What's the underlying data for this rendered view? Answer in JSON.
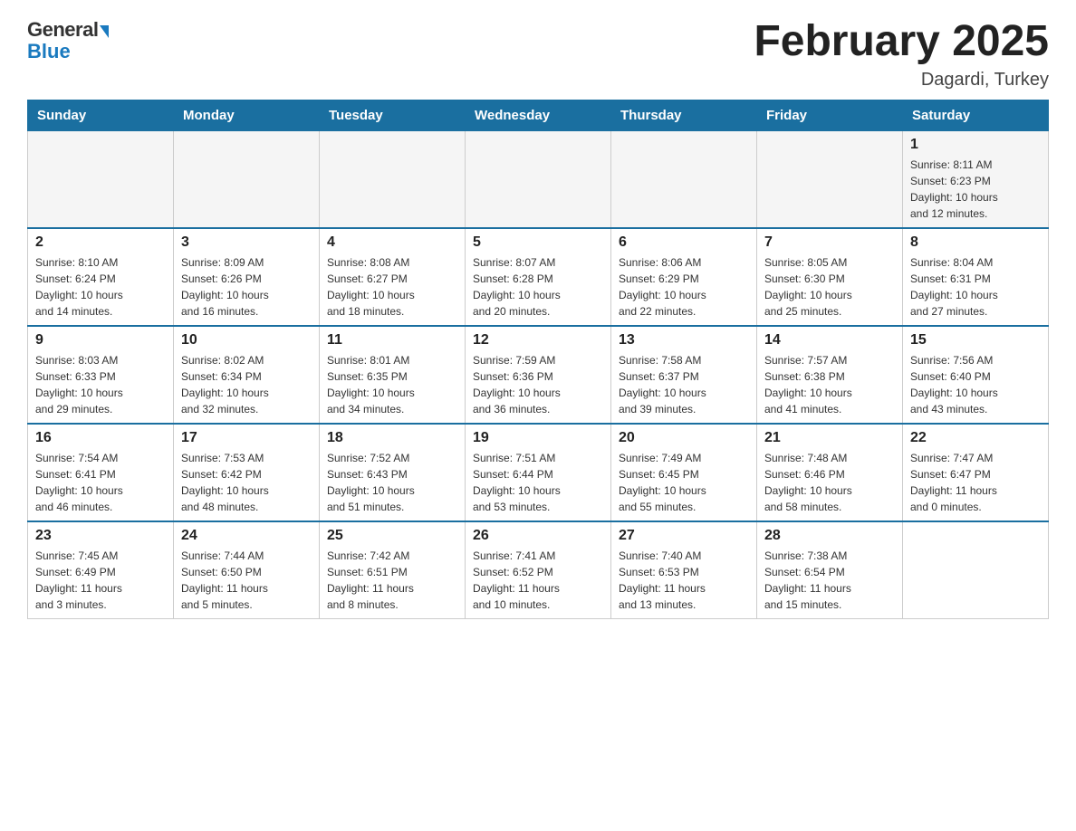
{
  "logo": {
    "general": "General",
    "blue": "Blue"
  },
  "header": {
    "title": "February 2025",
    "location": "Dagardi, Turkey"
  },
  "weekdays": [
    "Sunday",
    "Monday",
    "Tuesday",
    "Wednesday",
    "Thursday",
    "Friday",
    "Saturday"
  ],
  "weeks": [
    [
      {
        "day": "",
        "info": ""
      },
      {
        "day": "",
        "info": ""
      },
      {
        "day": "",
        "info": ""
      },
      {
        "day": "",
        "info": ""
      },
      {
        "day": "",
        "info": ""
      },
      {
        "day": "",
        "info": ""
      },
      {
        "day": "1",
        "info": "Sunrise: 8:11 AM\nSunset: 6:23 PM\nDaylight: 10 hours\nand 12 minutes."
      }
    ],
    [
      {
        "day": "2",
        "info": "Sunrise: 8:10 AM\nSunset: 6:24 PM\nDaylight: 10 hours\nand 14 minutes."
      },
      {
        "day": "3",
        "info": "Sunrise: 8:09 AM\nSunset: 6:26 PM\nDaylight: 10 hours\nand 16 minutes."
      },
      {
        "day": "4",
        "info": "Sunrise: 8:08 AM\nSunset: 6:27 PM\nDaylight: 10 hours\nand 18 minutes."
      },
      {
        "day": "5",
        "info": "Sunrise: 8:07 AM\nSunset: 6:28 PM\nDaylight: 10 hours\nand 20 minutes."
      },
      {
        "day": "6",
        "info": "Sunrise: 8:06 AM\nSunset: 6:29 PM\nDaylight: 10 hours\nand 22 minutes."
      },
      {
        "day": "7",
        "info": "Sunrise: 8:05 AM\nSunset: 6:30 PM\nDaylight: 10 hours\nand 25 minutes."
      },
      {
        "day": "8",
        "info": "Sunrise: 8:04 AM\nSunset: 6:31 PM\nDaylight: 10 hours\nand 27 minutes."
      }
    ],
    [
      {
        "day": "9",
        "info": "Sunrise: 8:03 AM\nSunset: 6:33 PM\nDaylight: 10 hours\nand 29 minutes."
      },
      {
        "day": "10",
        "info": "Sunrise: 8:02 AM\nSunset: 6:34 PM\nDaylight: 10 hours\nand 32 minutes."
      },
      {
        "day": "11",
        "info": "Sunrise: 8:01 AM\nSunset: 6:35 PM\nDaylight: 10 hours\nand 34 minutes."
      },
      {
        "day": "12",
        "info": "Sunrise: 7:59 AM\nSunset: 6:36 PM\nDaylight: 10 hours\nand 36 minutes."
      },
      {
        "day": "13",
        "info": "Sunrise: 7:58 AM\nSunset: 6:37 PM\nDaylight: 10 hours\nand 39 minutes."
      },
      {
        "day": "14",
        "info": "Sunrise: 7:57 AM\nSunset: 6:38 PM\nDaylight: 10 hours\nand 41 minutes."
      },
      {
        "day": "15",
        "info": "Sunrise: 7:56 AM\nSunset: 6:40 PM\nDaylight: 10 hours\nand 43 minutes."
      }
    ],
    [
      {
        "day": "16",
        "info": "Sunrise: 7:54 AM\nSunset: 6:41 PM\nDaylight: 10 hours\nand 46 minutes."
      },
      {
        "day": "17",
        "info": "Sunrise: 7:53 AM\nSunset: 6:42 PM\nDaylight: 10 hours\nand 48 minutes."
      },
      {
        "day": "18",
        "info": "Sunrise: 7:52 AM\nSunset: 6:43 PM\nDaylight: 10 hours\nand 51 minutes."
      },
      {
        "day": "19",
        "info": "Sunrise: 7:51 AM\nSunset: 6:44 PM\nDaylight: 10 hours\nand 53 minutes."
      },
      {
        "day": "20",
        "info": "Sunrise: 7:49 AM\nSunset: 6:45 PM\nDaylight: 10 hours\nand 55 minutes."
      },
      {
        "day": "21",
        "info": "Sunrise: 7:48 AM\nSunset: 6:46 PM\nDaylight: 10 hours\nand 58 minutes."
      },
      {
        "day": "22",
        "info": "Sunrise: 7:47 AM\nSunset: 6:47 PM\nDaylight: 11 hours\nand 0 minutes."
      }
    ],
    [
      {
        "day": "23",
        "info": "Sunrise: 7:45 AM\nSunset: 6:49 PM\nDaylight: 11 hours\nand 3 minutes."
      },
      {
        "day": "24",
        "info": "Sunrise: 7:44 AM\nSunset: 6:50 PM\nDaylight: 11 hours\nand 5 minutes."
      },
      {
        "day": "25",
        "info": "Sunrise: 7:42 AM\nSunset: 6:51 PM\nDaylight: 11 hours\nand 8 minutes."
      },
      {
        "day": "26",
        "info": "Sunrise: 7:41 AM\nSunset: 6:52 PM\nDaylight: 11 hours\nand 10 minutes."
      },
      {
        "day": "27",
        "info": "Sunrise: 7:40 AM\nSunset: 6:53 PM\nDaylight: 11 hours\nand 13 minutes."
      },
      {
        "day": "28",
        "info": "Sunrise: 7:38 AM\nSunset: 6:54 PM\nDaylight: 11 hours\nand 15 minutes."
      },
      {
        "day": "",
        "info": ""
      }
    ]
  ]
}
